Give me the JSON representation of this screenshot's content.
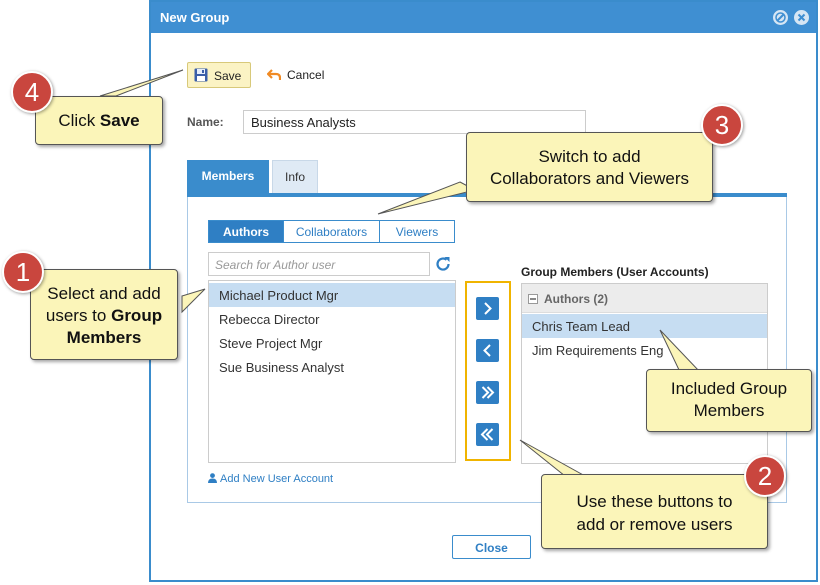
{
  "dialog": {
    "title": "New Group",
    "toolbar": {
      "save_label": "Save",
      "cancel_label": "Cancel"
    },
    "name_label": "Name:",
    "name_value": "Business Analysts",
    "tabs": [
      {
        "label": "Members"
      },
      {
        "label": "Info"
      }
    ],
    "member_types": [
      {
        "label": "Authors"
      },
      {
        "label": "Collaborators"
      },
      {
        "label": "Viewers"
      }
    ],
    "search_placeholder": "Search for Author user",
    "available_users": [
      {
        "label": "Michael Product Mgr"
      },
      {
        "label": "Rebecca Director"
      },
      {
        "label": "Steve Project Mgr"
      },
      {
        "label": "Sue Business Analyst"
      }
    ],
    "add_user_link": "Add New User Account",
    "group_members_title": "Group Members (User Accounts)",
    "group": {
      "label": "Authors (2)"
    },
    "members": [
      {
        "label": "Chris Team Lead"
      },
      {
        "label": "Jim Requirements Eng"
      }
    ],
    "close_label": "Close"
  },
  "callouts": {
    "c1": {
      "number": "1",
      "text_a": "Select and add",
      "text_b": "users to ",
      "text_b_bold": "Group",
      "text_c_bold": "Members"
    },
    "c2": {
      "number": "2",
      "text_a": "Use these buttons to",
      "text_b": "add or remove users"
    },
    "c3": {
      "number": "3",
      "text_a": "Switch to add",
      "text_b": "Collaborators and Viewers"
    },
    "c4": {
      "number": "4",
      "text_a": "Click ",
      "text_bold": "Save"
    },
    "c5": {
      "text_a": "Included Group",
      "text_b": "Members"
    }
  },
  "colors": {
    "accent": "#3a8ccc",
    "callout_bg": "#fbf5b9",
    "badge": "#c9463e",
    "highlight_frame": "#f0b400"
  }
}
